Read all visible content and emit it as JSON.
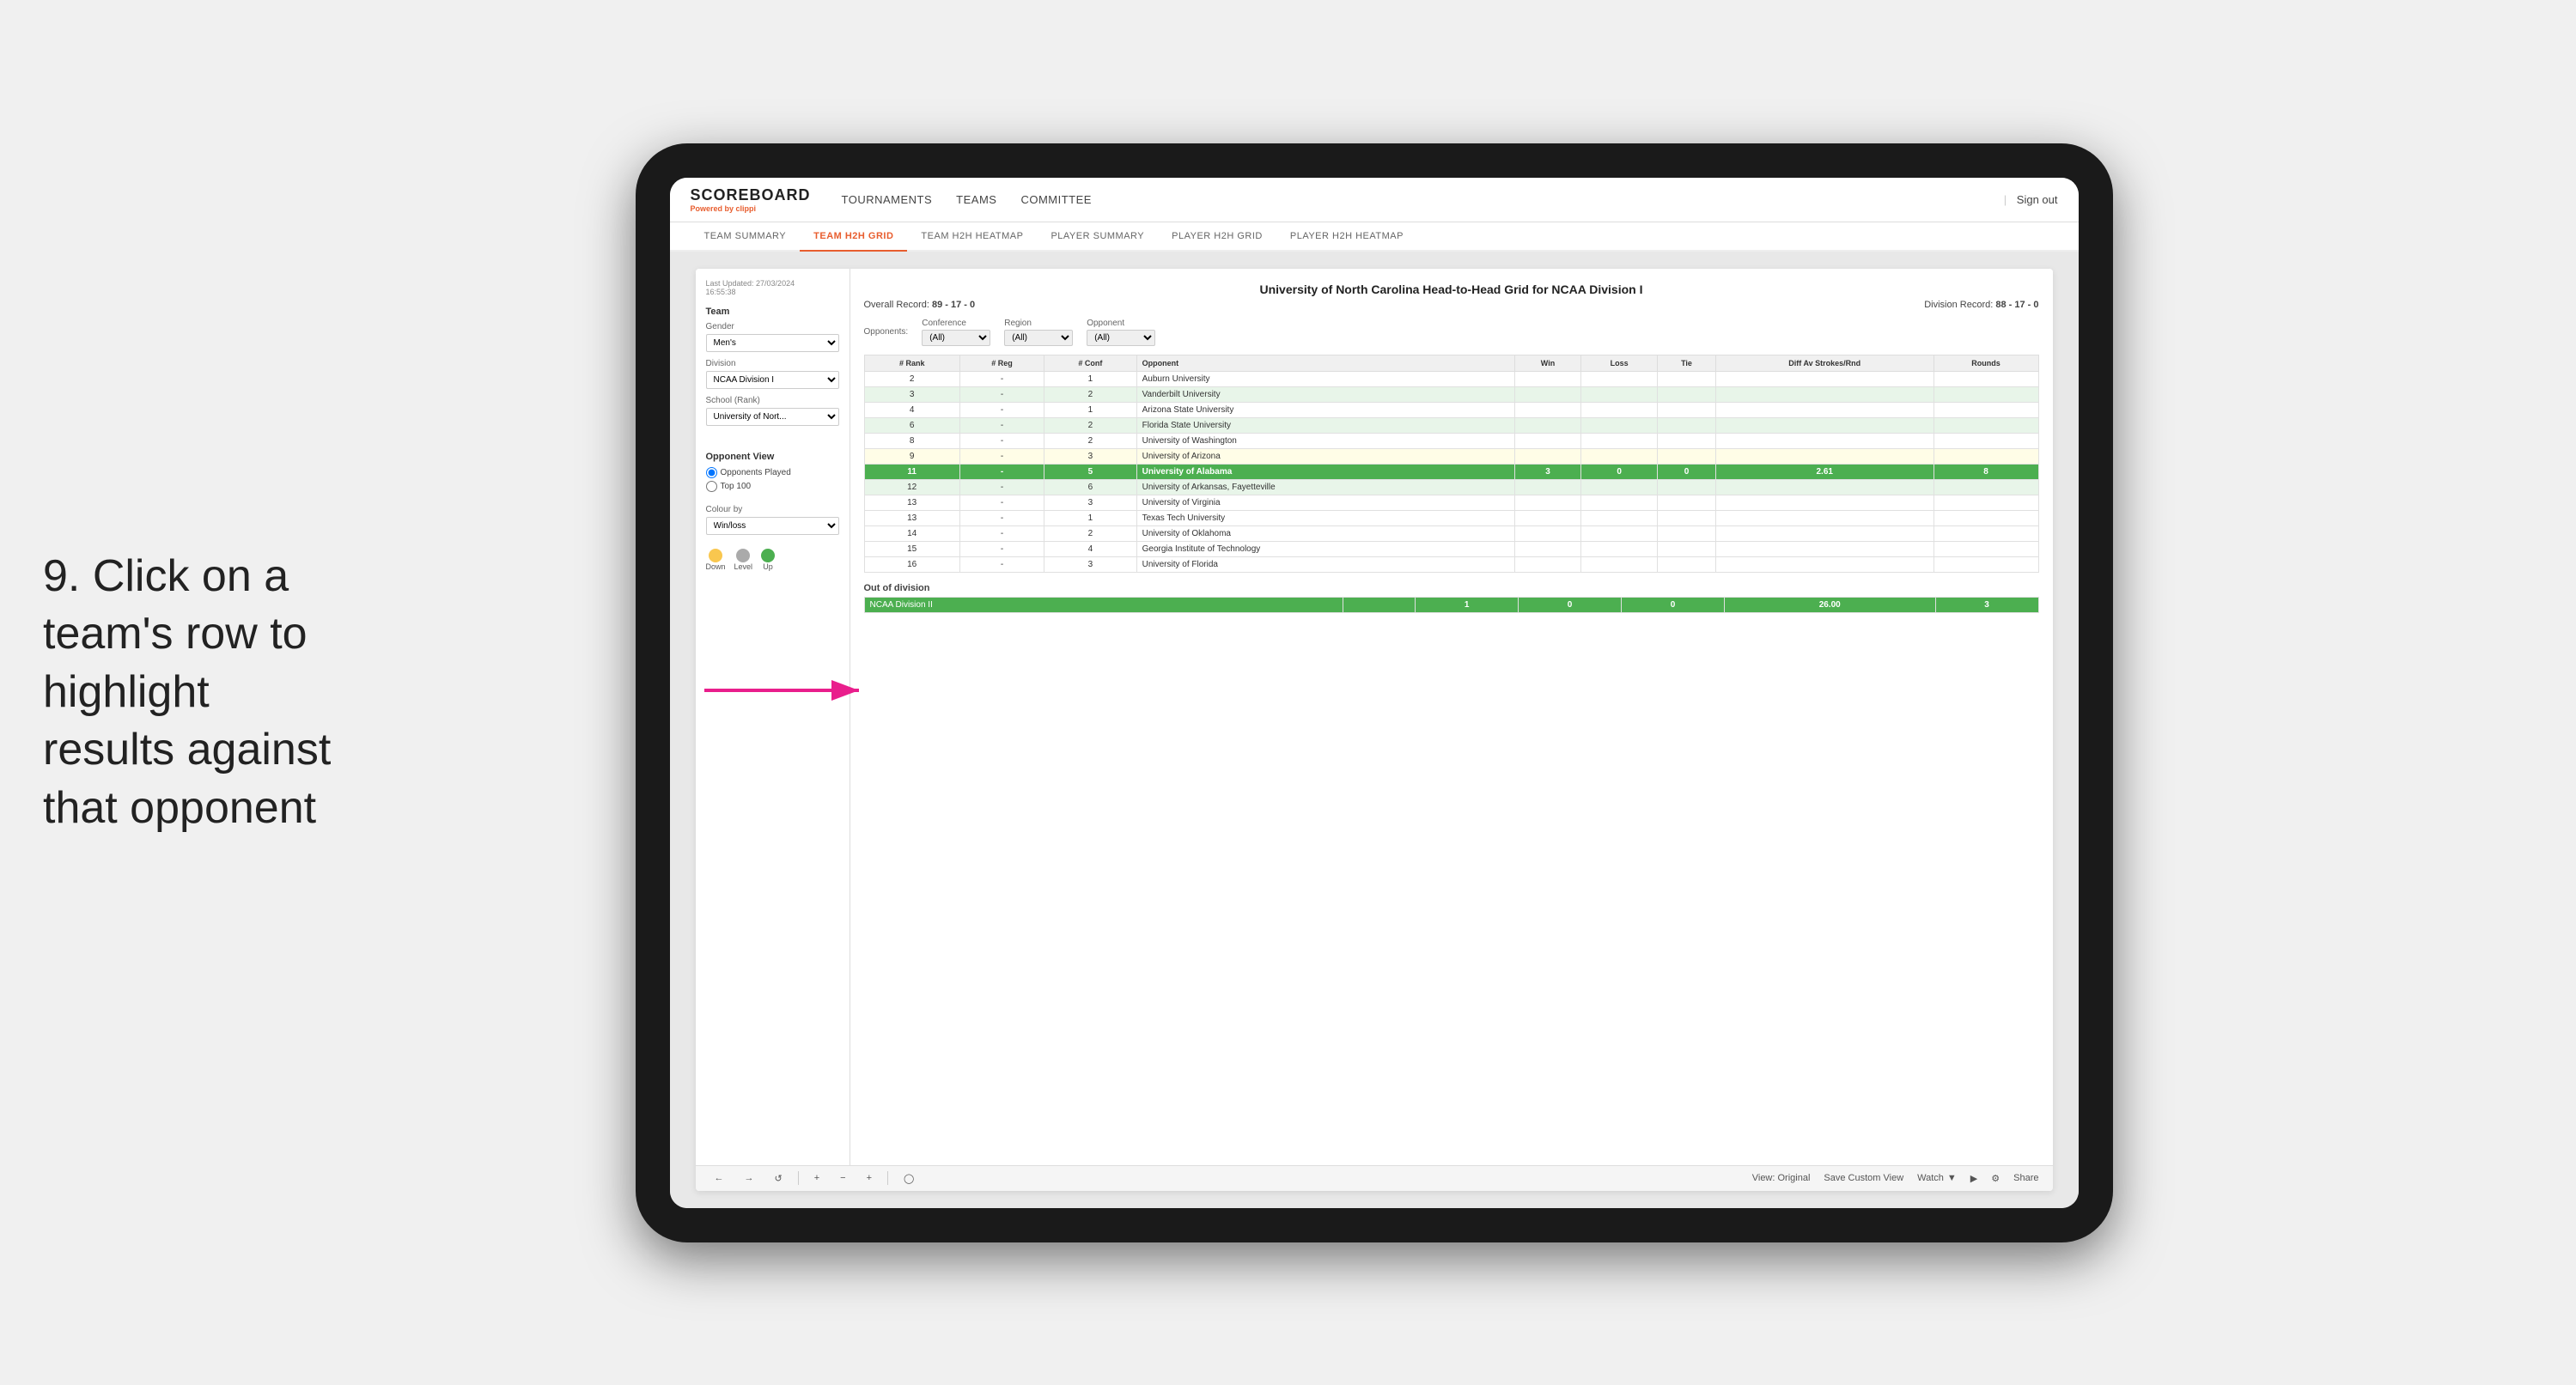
{
  "instruction": {
    "number": "9.",
    "text": "Click on a team's row to highlight results against that opponent"
  },
  "app": {
    "logo": "SCOREBOARD",
    "logo_sub": "Powered by ",
    "logo_brand": "clippi",
    "nav": {
      "tournaments": "TOURNAMENTS",
      "teams": "TEAMS",
      "committee": "COMMITTEE"
    },
    "sign_in_separator": "|",
    "sign_in": "Sign out"
  },
  "sub_nav": {
    "items": [
      {
        "label": "TEAM SUMMARY",
        "active": false
      },
      {
        "label": "TEAM H2H GRID",
        "active": true
      },
      {
        "label": "TEAM H2H HEATMAP",
        "active": false
      },
      {
        "label": "PLAYER SUMMARY",
        "active": false
      },
      {
        "label": "PLAYER H2H GRID",
        "active": false
      },
      {
        "label": "PLAYER H2H HEATMAP",
        "active": false
      }
    ]
  },
  "left_panel": {
    "timestamp_label": "Last Updated: 27/03/2024",
    "timestamp_time": "16:55:38",
    "team_section": "Team",
    "gender_label": "Gender",
    "gender_value": "Men's",
    "division_label": "Division",
    "division_value": "NCAA Division I",
    "school_label": "School (Rank)",
    "school_value": "University of Nort...",
    "opponent_view_label": "Opponent View",
    "radio_options": [
      {
        "label": "Opponents Played",
        "selected": true
      },
      {
        "label": "Top 100",
        "selected": false
      }
    ],
    "colour_by_label": "Colour by",
    "colour_by_value": "Win/loss",
    "legend": [
      {
        "color": "#f9c74f",
        "label": "Down"
      },
      {
        "color": "#aaa",
        "label": "Level"
      },
      {
        "color": "#4caf50",
        "label": "Up"
      }
    ]
  },
  "grid": {
    "title": "University of North Carolina Head-to-Head Grid for NCAA Division I",
    "overall_record_label": "Overall Record:",
    "overall_record": "89 - 17 - 0",
    "division_record_label": "Division Record:",
    "division_record": "88 - 17 - 0",
    "filters": {
      "conference_label": "Conference",
      "conference_value": "(All)",
      "region_label": "Region",
      "region_value": "(All)",
      "opponent_label": "Opponent",
      "opponent_value": "(All)"
    },
    "opponents_label": "Opponents:",
    "columns": [
      "# Rank",
      "# Reg",
      "# Conf",
      "Opponent",
      "Win",
      "Loss",
      "Tie",
      "Diff Av Strokes/Rnd",
      "Rounds"
    ],
    "rows": [
      {
        "rank": "2",
        "reg": "-",
        "conf": "1",
        "opponent": "Auburn University",
        "win": "",
        "loss": "",
        "tie": "",
        "diff": "",
        "rounds": "",
        "style": "normal"
      },
      {
        "rank": "3",
        "reg": "-",
        "conf": "2",
        "opponent": "Vanderbilt University",
        "win": "",
        "loss": "",
        "tie": "",
        "diff": "",
        "rounds": "",
        "style": "light-green"
      },
      {
        "rank": "4",
        "reg": "-",
        "conf": "1",
        "opponent": "Arizona State University",
        "win": "",
        "loss": "",
        "tie": "",
        "diff": "",
        "rounds": "",
        "style": "normal"
      },
      {
        "rank": "6",
        "reg": "-",
        "conf": "2",
        "opponent": "Florida State University",
        "win": "",
        "loss": "",
        "tie": "",
        "diff": "",
        "rounds": "",
        "style": "light-green"
      },
      {
        "rank": "8",
        "reg": "-",
        "conf": "2",
        "opponent": "University of Washington",
        "win": "",
        "loss": "",
        "tie": "",
        "diff": "",
        "rounds": "",
        "style": "normal"
      },
      {
        "rank": "9",
        "reg": "-",
        "conf": "3",
        "opponent": "University of Arizona",
        "win": "",
        "loss": "",
        "tie": "",
        "diff": "",
        "rounds": "",
        "style": "light-yellow"
      },
      {
        "rank": "11",
        "reg": "-",
        "conf": "5",
        "opponent": "University of Alabama",
        "win": "3",
        "loss": "0",
        "tie": "0",
        "diff": "2.61",
        "rounds": "8",
        "style": "highlighted"
      },
      {
        "rank": "12",
        "reg": "-",
        "conf": "6",
        "opponent": "University of Arkansas, Fayetteville",
        "win": "",
        "loss": "",
        "tie": "",
        "diff": "",
        "rounds": "",
        "style": "light-green"
      },
      {
        "rank": "13",
        "reg": "-",
        "conf": "3",
        "opponent": "University of Virginia",
        "win": "",
        "loss": "",
        "tie": "",
        "diff": "",
        "rounds": "",
        "style": "normal"
      },
      {
        "rank": "13",
        "reg": "-",
        "conf": "1",
        "opponent": "Texas Tech University",
        "win": "",
        "loss": "",
        "tie": "",
        "diff": "",
        "rounds": "",
        "style": "normal"
      },
      {
        "rank": "14",
        "reg": "-",
        "conf": "2",
        "opponent": "University of Oklahoma",
        "win": "",
        "loss": "",
        "tie": "",
        "diff": "",
        "rounds": "",
        "style": "normal"
      },
      {
        "rank": "15",
        "reg": "-",
        "conf": "4",
        "opponent": "Georgia Institute of Technology",
        "win": "",
        "loss": "",
        "tie": "",
        "diff": "",
        "rounds": "",
        "style": "normal"
      },
      {
        "rank": "16",
        "reg": "-",
        "conf": "3",
        "opponent": "University of Florida",
        "win": "",
        "loss": "",
        "tie": "",
        "diff": "",
        "rounds": "",
        "style": "normal"
      }
    ],
    "out_of_division_label": "Out of division",
    "out_of_division_row": {
      "division": "NCAA Division II",
      "win": "1",
      "loss": "0",
      "tie": "0",
      "diff": "26.00",
      "rounds": "3",
      "style": "highlighted"
    }
  },
  "toolbar": {
    "view_label": "View: Original",
    "save_label": "Save Custom View",
    "watch_label": "Watch",
    "share_label": "Share"
  }
}
